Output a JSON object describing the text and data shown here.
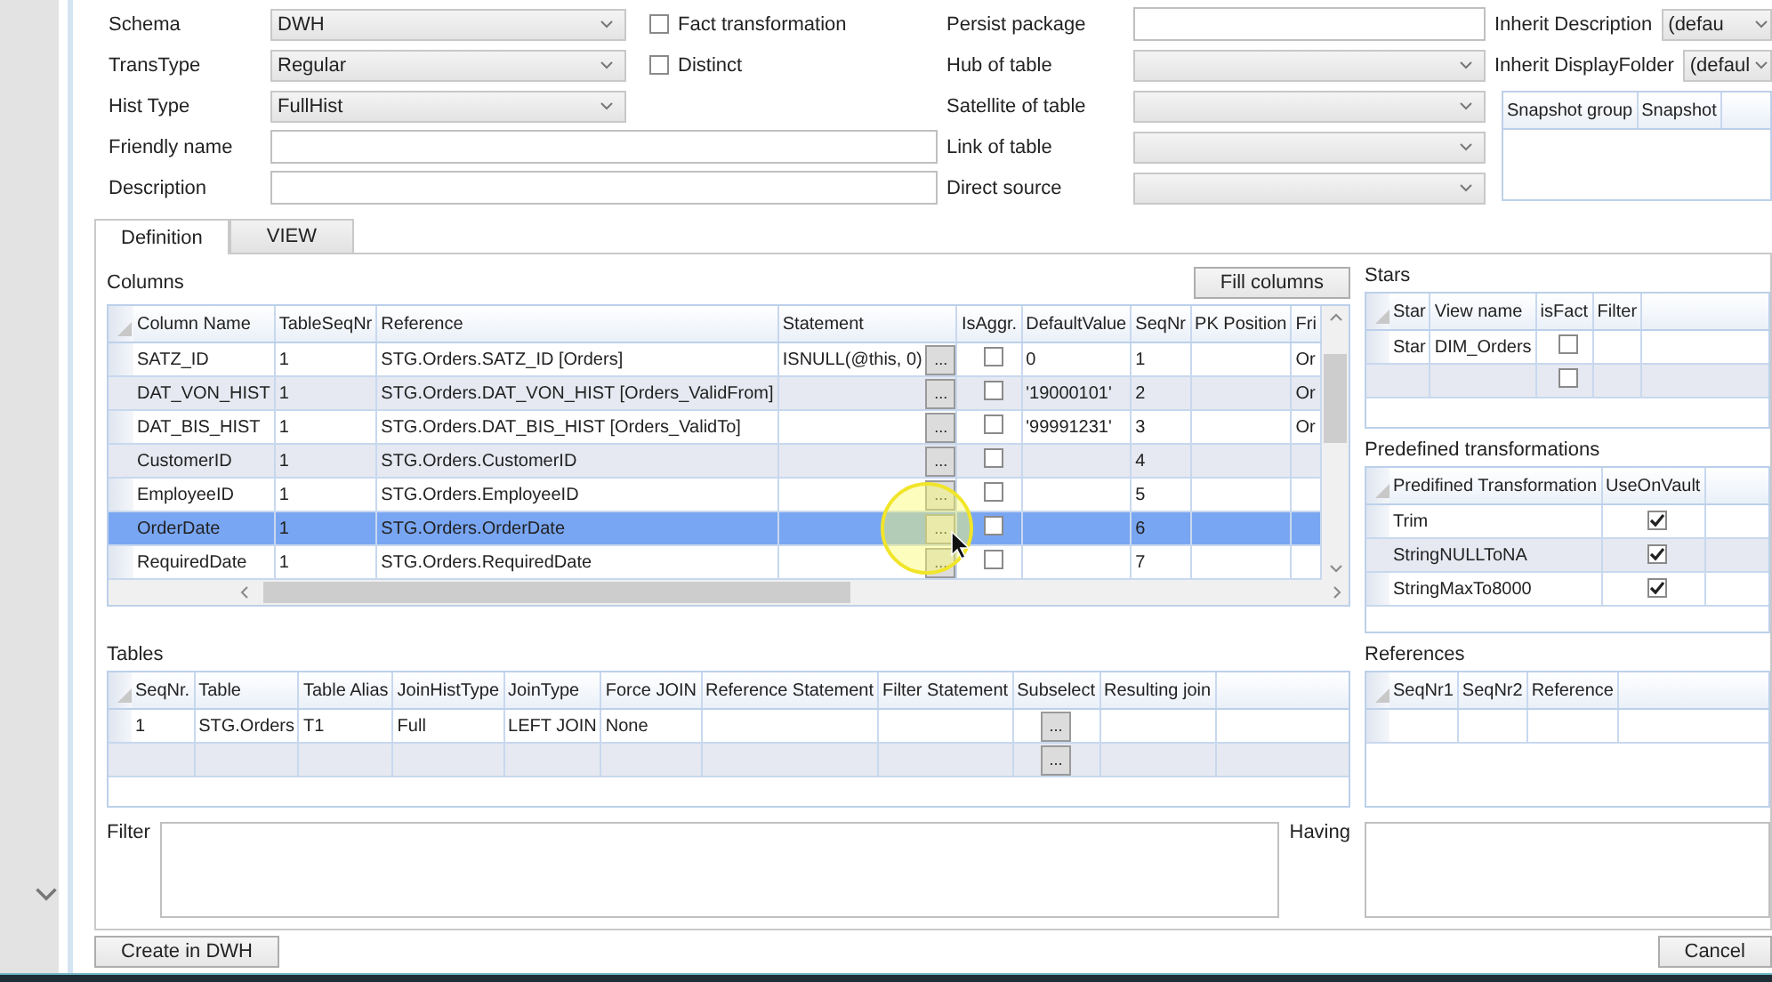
{
  "left_fields": [
    {
      "label": "Schema",
      "kind": "dropdown",
      "value": "DWH"
    },
    {
      "label": "TransType",
      "kind": "dropdown",
      "value": "Regular"
    },
    {
      "label": "Hist Type",
      "kind": "dropdown",
      "value": "FullHist"
    },
    {
      "label": "Friendly name",
      "kind": "text"
    },
    {
      "label": "Description",
      "kind": "text"
    }
  ],
  "options": [
    {
      "label": "Fact transformation",
      "checked": false
    },
    {
      "label": "Distinct",
      "checked": false
    }
  ],
  "middle_fields": [
    {
      "label": "Persist package",
      "kind": "text"
    },
    {
      "label": "Hub of table",
      "kind": "dropdown"
    },
    {
      "label": "Satellite of table",
      "kind": "dropdown"
    },
    {
      "label": "Link of table",
      "kind": "dropdown"
    },
    {
      "label": "Direct source",
      "kind": "dropdown"
    }
  ],
  "right_fields": [
    {
      "label": "Inherit Description",
      "kind": "dropdown",
      "value": "(defau"
    },
    {
      "label": "Inherit DisplayFolder",
      "kind": "dropdown",
      "value": "(defaul"
    }
  ],
  "snapshot_grid": {
    "columns": [
      "Snapshot group",
      "Snapshot"
    ]
  },
  "tabs": [
    {
      "label": "Definition",
      "selected": true
    },
    {
      "label": "VIEW",
      "selected": false
    }
  ],
  "columns_section": {
    "title": "Columns",
    "button": "Fill columns",
    "grid": {
      "columns": [
        "Column Name",
        "TableSeqNr",
        "Reference",
        "Statement",
        "IsAggr.",
        "DefaultValue",
        "SeqNr",
        "PK Position",
        "Fri"
      ],
      "rows": [
        {
          "selected": false,
          "cells": [
            "SATZ_ID",
            "1",
            "STG.Orders.SATZ_ID [Orders]",
            {
              "kind": "statement",
              "text": "ISNULL(@this, 0)",
              "button": "..."
            },
            {
              "kind": "checkbox",
              "checked": false
            },
            "0",
            "1",
            null,
            "Or"
          ]
        },
        {
          "selected": false,
          "cells": [
            "DAT_VON_HIST",
            "1",
            "STG.Orders.DAT_VON_HIST [Orders_ValidFrom]",
            {
              "kind": "statement",
              "button": "..."
            },
            {
              "kind": "checkbox",
              "checked": false
            },
            "'19000101'",
            "2",
            null,
            "Or"
          ]
        },
        {
          "selected": false,
          "cells": [
            "DAT_BIS_HIST",
            "1",
            "STG.Orders.DAT_BIS_HIST [Orders_ValidTo]",
            {
              "kind": "statement",
              "button": "..."
            },
            {
              "kind": "checkbox",
              "checked": false
            },
            "'99991231'",
            "3",
            null,
            "Or"
          ]
        },
        {
          "selected": false,
          "cells": [
            "CustomerID",
            "1",
            "STG.Orders.CustomerID",
            {
              "kind": "statement",
              "button": "..."
            },
            {
              "kind": "checkbox",
              "checked": false
            },
            null,
            "4",
            null,
            null
          ]
        },
        {
          "selected": false,
          "cells": [
            "EmployeeID",
            "1",
            "STG.Orders.EmployeeID",
            {
              "kind": "statement",
              "button": "..."
            },
            {
              "kind": "checkbox",
              "checked": false
            },
            null,
            "5",
            null,
            null
          ]
        },
        {
          "selected": true,
          "cells": [
            "OrderDate",
            "1",
            "STG.Orders.OrderDate",
            {
              "kind": "statement",
              "button": "..."
            },
            {
              "kind": "checkbox",
              "checked": false
            },
            null,
            "6",
            null,
            null
          ]
        },
        {
          "selected": false,
          "cells": [
            "RequiredDate",
            "1",
            "STG.Orders.RequiredDate",
            {
              "kind": "statement",
              "button": "..."
            },
            {
              "kind": "checkbox",
              "checked": false
            },
            null,
            "7",
            null,
            null
          ]
        }
      ]
    }
  },
  "stars_section": {
    "title": "Stars",
    "grid": {
      "columns": [
        "Star",
        "View name",
        "isFact",
        "Filter"
      ],
      "rows": [
        {
          "cells": [
            "Star",
            "DIM_Orders",
            {
              "kind": "checkbox",
              "checked": false
            },
            null
          ]
        },
        {
          "cells": [
            null,
            null,
            {
              "kind": "checkbox",
              "checked": false
            },
            null
          ]
        }
      ]
    }
  },
  "transformations_section": {
    "title": "Predefined transformations",
    "grid": {
      "columns": [
        "Predifined Transformation",
        "UseOnVault"
      ],
      "rows": [
        {
          "cells": [
            "Trim",
            {
              "kind": "checkbox",
              "checked": true
            }
          ]
        },
        {
          "cells": [
            "StringNULLToNA",
            {
              "kind": "checkbox",
              "checked": true
            }
          ]
        },
        {
          "cells": [
            "StringMaxTo8000",
            {
              "kind": "checkbox",
              "checked": true
            }
          ]
        }
      ]
    }
  },
  "tables_section": {
    "title": "Tables",
    "grid": {
      "columns": [
        "SeqNr.",
        "Table",
        "Table Alias",
        "JoinHistType",
        "JoinType",
        "Force JOIN",
        "Reference Statement",
        "Filter Statement",
        "Subselect",
        "Resulting join"
      ],
      "rows": [
        {
          "cells": [
            "1",
            "STG.Orders",
            "T1",
            "Full",
            "LEFT JOIN",
            "None",
            null,
            null,
            {
              "kind": "button",
              "label": "..."
            },
            null
          ]
        },
        {
          "cells": [
            null,
            null,
            null,
            null,
            null,
            null,
            null,
            null,
            {
              "kind": "button",
              "label": "..."
            },
            null
          ]
        }
      ]
    }
  },
  "references_section": {
    "title": "References",
    "grid": {
      "columns": [
        "SeqNr1",
        "SeqNr2",
        "Reference"
      ],
      "rows": [
        {
          "cells": [
            null,
            null,
            null
          ]
        }
      ]
    }
  },
  "filter": {
    "label": "Filter"
  },
  "having": {
    "label": "Having"
  },
  "buttons": [
    {
      "label": "Create in DWH"
    },
    {
      "label": "Cancel"
    }
  ]
}
